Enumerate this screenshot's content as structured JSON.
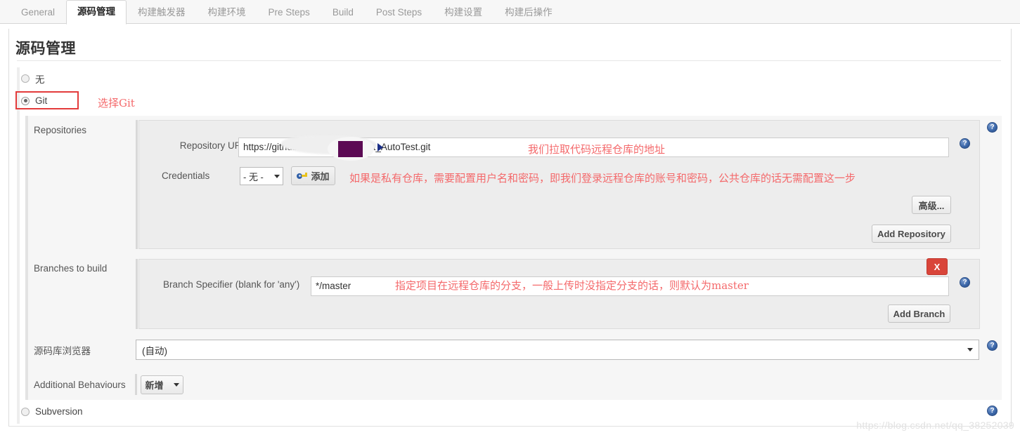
{
  "tabs": [
    {
      "label": "General",
      "active": false
    },
    {
      "label": "源码管理",
      "active": true
    },
    {
      "label": "构建触发器",
      "active": false
    },
    {
      "label": "构建环境",
      "active": false
    },
    {
      "label": "Pre Steps",
      "active": false
    },
    {
      "label": "Build",
      "active": false
    },
    {
      "label": "Post Steps",
      "active": false
    },
    {
      "label": "构建设置",
      "active": false
    },
    {
      "label": "构建后操作",
      "active": false
    }
  ],
  "page": {
    "title": "源码管理",
    "watermark": "https://blog.csdn.net/qq_38252039"
  },
  "scm_options": [
    {
      "label": "无",
      "checked": false
    },
    {
      "label": "Git",
      "checked": true
    },
    {
      "label": "Subversion",
      "checked": false
    }
  ],
  "annotations": {
    "select_git": "选择Git",
    "repo_url": "我们拉取代码远程仓库的地址",
    "credentials": "如果是私有仓库，需要配置用户名和密码，即我们登录远程仓库的账号和密码，公共仓库的话无需配置这一步",
    "branch": "指定项目在远程仓库的分支，一般上传时没指定分支的话，则默认为master"
  },
  "sections": {
    "repositories": {
      "label": "Repositories",
      "repository_url": {
        "label": "Repository URL",
        "value": "https://github.com/1          SpringBoot_AutoTest.git",
        "value_prefix": "https://github.com/1",
        "value_suffix": "SpringBoot_AutoTest.git"
      },
      "credentials": {
        "label": "Credentials",
        "selected": "- 无 -",
        "add_button": "添加",
        "add_icon": "key-icon"
      },
      "advanced_button": "高级...",
      "add_repository_button": "Add Repository"
    },
    "branches": {
      "label": "Branches to build",
      "branch_specifier": {
        "label": "Branch Specifier (blank for 'any')",
        "value": "*/master"
      },
      "delete_button": "X",
      "add_branch_button": "Add Branch"
    },
    "browser": {
      "label": "源码库浏览器",
      "selected": "(自动)"
    },
    "additional_behaviours": {
      "label": "Additional Behaviours",
      "add_button": "新增"
    }
  },
  "icons": {
    "help": "?"
  },
  "colors": {
    "accent_red": "#e33b3b",
    "annotation_red": "#f4696b",
    "help_blue": "#3d69ab",
    "delete_red": "#d9453a",
    "redaction_purple": "#5c0a54"
  }
}
